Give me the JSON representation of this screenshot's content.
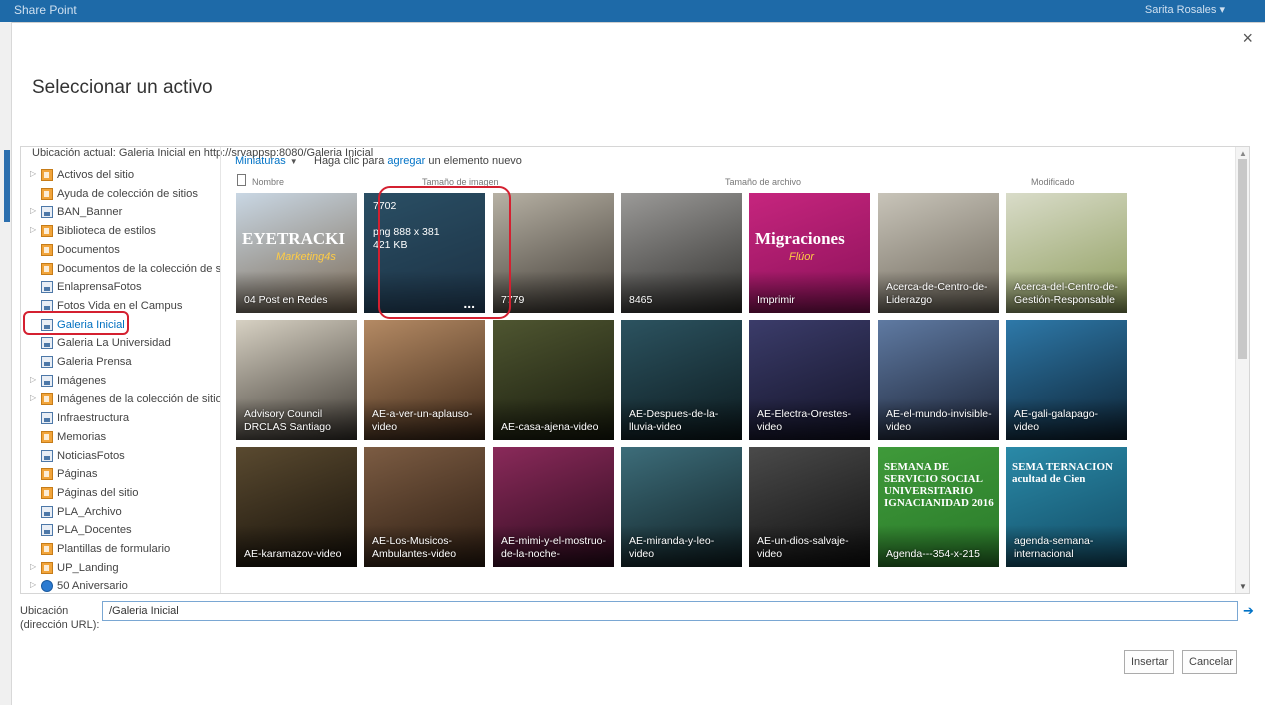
{
  "background": {
    "site_title": "Share Point",
    "user_area": "Sarita Rosales ▾"
  },
  "dialog": {
    "close": "×",
    "title": "Seleccionar un activo",
    "current_location": "Ubicación actual: Galeria Inicial en http://srvappsp:8080/Galeria Inicial"
  },
  "tree": {
    "items": [
      {
        "label": "Activos del sitio",
        "icon": "library-icon",
        "expandable": true
      },
      {
        "label": "Ayuda de colección de sitios",
        "icon": "library-icon",
        "expandable": false
      },
      {
        "label": "BAN_Banner",
        "icon": "picture-library-icon",
        "expandable": true
      },
      {
        "label": "Biblioteca de estilos",
        "icon": "library-icon",
        "expandable": true
      },
      {
        "label": "Documentos",
        "icon": "library-icon",
        "expandable": false
      },
      {
        "label": "Documentos de la colección de sit",
        "icon": "library-icon",
        "expandable": false
      },
      {
        "label": "EnlaprensaFotos",
        "icon": "picture-library-icon",
        "expandable": false
      },
      {
        "label": "Fotos Vida en el Campus",
        "icon": "picture-library-icon",
        "expandable": false
      },
      {
        "label": "Galeria Inicial",
        "icon": "picture-library-icon",
        "expandable": false,
        "selected": true
      },
      {
        "label": "Galeria La Universidad",
        "icon": "picture-library-icon",
        "expandable": false
      },
      {
        "label": "Galeria Prensa",
        "icon": "picture-library-icon",
        "expandable": false
      },
      {
        "label": "Imágenes",
        "icon": "picture-library-icon",
        "expandable": true
      },
      {
        "label": "Imágenes de la colección de sitios",
        "icon": "library-icon",
        "expandable": true
      },
      {
        "label": "Infraestructura",
        "icon": "picture-library-icon",
        "expandable": false
      },
      {
        "label": "Memorias",
        "icon": "library-icon",
        "expandable": false
      },
      {
        "label": "NoticiasFotos",
        "icon": "picture-library-icon",
        "expandable": false
      },
      {
        "label": "Páginas",
        "icon": "library-icon",
        "expandable": false
      },
      {
        "label": "Páginas del sitio",
        "icon": "library-icon",
        "expandable": false
      },
      {
        "label": "PLA_Archivo",
        "icon": "picture-library-icon",
        "expandable": false
      },
      {
        "label": "PLA_Docentes",
        "icon": "picture-library-icon",
        "expandable": false
      },
      {
        "label": "Plantillas de formulario",
        "icon": "library-icon",
        "expandable": false
      },
      {
        "label": "UP_Landing",
        "icon": "library-icon",
        "expandable": true
      },
      {
        "label": "50 Aniversario",
        "icon": "globe-icon",
        "expandable": true
      }
    ]
  },
  "toolbar": {
    "view_label": "Miniaturas",
    "hint_prefix": "Haga clic para ",
    "hint_link": "agregar",
    "hint_suffix": " un elemento nuevo"
  },
  "columns": {
    "name": "Nombre",
    "image_size": "Tamaño de imagen",
    "file_size": "Tamaño de archivo",
    "modified": "Modificado"
  },
  "tiles": [
    {
      "label": "04 Post en Redes",
      "colors": [
        "#c9d7e4",
        "#7b6a55"
      ],
      "overlay_text": "EYETRACKI",
      "overlay_sub": "Marketing4s"
    },
    {
      "label": "7702",
      "colors": [
        "#3d6f86",
        "#23394a"
      ],
      "hover": true
    },
    {
      "label": "7779",
      "colors": [
        "#b7b1a4",
        "#3e3933"
      ]
    },
    {
      "label": "8465",
      "colors": [
        "#9b9a98",
        "#2f2e2c"
      ]
    },
    {
      "label": "Imprimir",
      "colors": [
        "#c6257e",
        "#8a1158"
      ],
      "overlay_text": "Migraciones",
      "overlay_sub": "Flúor"
    },
    {
      "label": "Acerca-de-Centro-de-Liderazgo",
      "colors": [
        "#c8c4b9",
        "#6b6458"
      ]
    },
    {
      "label": "Acerca-del-Centro-de-Gestión-Responsable",
      "colors": [
        "#d9dcc9",
        "#8c9b5a"
      ]
    },
    {
      "label": "Advisory Council DRCLAS Santiago",
      "colors": [
        "#d7d1c3",
        "#3b3630"
      ]
    },
    {
      "label": "AE-a-ver-un-aplauso-video",
      "colors": [
        "#b48a64",
        "#3c2616"
      ]
    },
    {
      "label": "AE-casa-ajena-video",
      "colors": [
        "#4f5631",
        "#171a0c"
      ]
    },
    {
      "label": "AE-Despues-de-la-lluvia-video",
      "colors": [
        "#2c5360",
        "#0c1a1e"
      ]
    },
    {
      "label": "AE-Electra-Orestes-video",
      "colors": [
        "#3b3c6a",
        "#121226"
      ]
    },
    {
      "label": "AE-el-mundo-invisible-video",
      "colors": [
        "#5f7aa2",
        "#1a2133"
      ]
    },
    {
      "label": "AE-gali-galapago-video",
      "colors": [
        "#2e79a9",
        "#0d2233"
      ]
    },
    {
      "label": "AE-karamazov-video",
      "colors": [
        "#5a4a30",
        "#140f08"
      ]
    },
    {
      "label": "AE-Los-Musicos-Ambulantes-video",
      "colors": [
        "#7c5c43",
        "#2a1b10"
      ]
    },
    {
      "label": "AE-mimi-y-el-mostruo-de-la-noche-",
      "colors": [
        "#8a2a5a",
        "#2a0a1c"
      ]
    },
    {
      "label": "AE-miranda-y-leo-video",
      "colors": [
        "#3d6d7a",
        "#0f1f23"
      ]
    },
    {
      "label": "AE-un-dios-salvaje-video",
      "colors": [
        "#4a4a4a",
        "#0f0f0f"
      ]
    },
    {
      "label": "Agenda---354-x-215",
      "colors": [
        "#3f9a3a",
        "#2a7a2a"
      ],
      "overlay_text": "SEMANA DE SERVICIO SOCIAL UNIVERSITARIO IGNACIANIDAD 2016"
    },
    {
      "label": "agenda-semana-internacional",
      "colors": [
        "#2a8aa8",
        "#124a63"
      ],
      "overlay_text": "SEMA TERNACION acultad de Cien"
    }
  ],
  "hover_info": {
    "name": "7702",
    "dims": "png 888 x 381",
    "size": "421 KB",
    "more": "..."
  },
  "url": {
    "label_line1": "Ubicación",
    "label_line2": "(dirección URL):",
    "value": "/Galeria Inicial",
    "go": "➔"
  },
  "buttons": {
    "insert": "Insertar",
    "cancel": "Cancelar"
  },
  "colors": {
    "accent": "#0072c6",
    "highlight": "#d42030"
  }
}
